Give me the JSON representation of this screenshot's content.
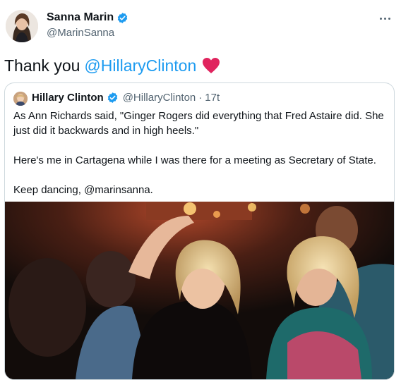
{
  "tweet": {
    "author_name": "Sanna Marin",
    "author_handle": "@MarinSanna",
    "text": "Thank you",
    "mention": "@HillaryClinton"
  },
  "quoted": {
    "author_name": "Hillary Clinton",
    "author_handle": "@HillaryClinton",
    "separator": "·",
    "time": "17t",
    "paragraphs": [
      "As Ann Richards said, \"Ginger Rogers did everything that Fred Astaire did. She just did it backwards and in high heels.\"",
      "Here's me in Cartagena while I was there for a meeting as Secretary of State.",
      "Keep dancing, @marinsanna."
    ]
  },
  "colors": {
    "accent": "#1d9bf0",
    "heart": "#f91880",
    "secondary_text": "#536471",
    "border": "#cfd9de"
  },
  "icons": {
    "verified": "verified-badge-icon",
    "more": "more-options-icon",
    "heart": "red-heart-emoji"
  }
}
